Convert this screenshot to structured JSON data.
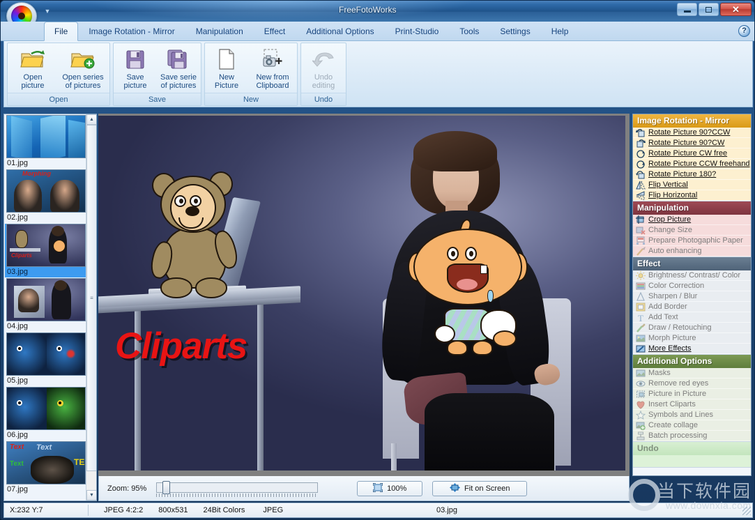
{
  "window": {
    "title": "FreeFotoWorks",
    "controls": {
      "minimize": "_",
      "maximize": "□",
      "close": "✕"
    },
    "quick_access_arrow": "▼"
  },
  "menubar": {
    "tabs": [
      {
        "label": "File",
        "active": true
      },
      {
        "label": "Image Rotation - Mirror",
        "active": false
      },
      {
        "label": "Manipulation",
        "active": false
      },
      {
        "label": "Effect",
        "active": false
      },
      {
        "label": "Additional Options",
        "active": false
      },
      {
        "label": "Print-Studio",
        "active": false
      },
      {
        "label": "Tools",
        "active": false
      },
      {
        "label": "Settings",
        "active": false
      },
      {
        "label": "Help",
        "active": false
      }
    ],
    "help_icon": "?"
  },
  "ribbon": {
    "groups": [
      {
        "name": "Open",
        "buttons": [
          {
            "label": "Open\npicture",
            "icon": "open-folder-icon",
            "disabled": false
          },
          {
            "label": "Open series\nof pictures",
            "icon": "open-folder-plus-icon",
            "disabled": false
          }
        ]
      },
      {
        "name": "Save",
        "buttons": [
          {
            "label": "Save\npicture",
            "icon": "floppy-disk-icon",
            "disabled": false
          },
          {
            "label": "Save serie\nof pictures",
            "icon": "floppy-disk-stack-icon",
            "disabled": false
          }
        ]
      },
      {
        "name": "New",
        "buttons": [
          {
            "label": "New\nPicture",
            "icon": "blank-page-icon",
            "disabled": false
          },
          {
            "label": "New from\nClipboard",
            "icon": "camera-clipboard-icon",
            "disabled": false
          }
        ]
      },
      {
        "name": "Undo",
        "buttons": [
          {
            "label": "Undo\nediting",
            "icon": "undo-arrow-icon",
            "disabled": true
          }
        ]
      }
    ]
  },
  "thumbnails": {
    "items": [
      {
        "name": "01.jpg",
        "selected": false
      },
      {
        "name": "02.jpg",
        "selected": false
      },
      {
        "name": "03.jpg",
        "selected": true
      },
      {
        "name": "04.jpg",
        "selected": false
      },
      {
        "name": "05.jpg",
        "selected": false
      },
      {
        "name": "06.jpg",
        "selected": false
      },
      {
        "name": "07.jpg",
        "selected": false
      }
    ],
    "scroll_up": "▲",
    "scroll_down": "▼",
    "scroll_grip": "≡"
  },
  "canvas": {
    "overlay_text": "Cliparts"
  },
  "zoombar": {
    "zoom_label": "Zoom: 95%",
    "btn_100": "100%",
    "btn_fit": "Fit on Screen",
    "btn_100_icon": "actual-size-icon",
    "btn_fit_icon": "fit-screen-icon"
  },
  "sidebar": {
    "sections": [
      {
        "title": "Image Rotation - Mirror",
        "key": "rot",
        "items": [
          {
            "label": "Rotate Picture 90?CCW",
            "icon": "rotate-ccw-icon",
            "enabled": true
          },
          {
            "label": "Rotate Picture 90?CW",
            "icon": "rotate-cw-icon",
            "enabled": true
          },
          {
            "label": "Rotate Picture CW free",
            "icon": "rotate-cw-free-icon",
            "enabled": true
          },
          {
            "label": "Rotate Picture CCW freehand",
            "icon": "rotate-ccw-free-icon",
            "enabled": true
          },
          {
            "label": "Rotate Picture 180?",
            "icon": "rotate-180-icon",
            "enabled": true
          },
          {
            "label": "Flip Vertical",
            "icon": "flip-vertical-icon",
            "enabled": true
          },
          {
            "label": "Flip Horizontal",
            "icon": "flip-horizontal-icon",
            "enabled": true
          }
        ]
      },
      {
        "title": "Manipulation",
        "key": "man",
        "items": [
          {
            "label": "Crop Picture",
            "icon": "crop-icon",
            "enabled": true
          },
          {
            "label": "Change Size",
            "icon": "resize-icon",
            "enabled": false
          },
          {
            "label": "Prepare Photogaphic Paper",
            "icon": "photo-paper-icon",
            "enabled": false
          },
          {
            "label": "Auto enhancing",
            "icon": "magic-wand-icon",
            "enabled": false
          }
        ]
      },
      {
        "title": "Effect",
        "key": "eff",
        "items": [
          {
            "label": "Brightness/ Contrast/ Color",
            "icon": "brightness-icon",
            "enabled": false
          },
          {
            "label": "Color Correction",
            "icon": "color-bars-icon",
            "enabled": false
          },
          {
            "label": "Sharpen / Blur",
            "icon": "sharpen-icon",
            "enabled": false
          },
          {
            "label": "Add Border",
            "icon": "border-icon",
            "enabled": false
          },
          {
            "label": "Add Text",
            "icon": "text-icon",
            "enabled": false
          },
          {
            "label": "Draw / Retouching",
            "icon": "brush-icon",
            "enabled": false
          },
          {
            "label": "Morph Picture",
            "icon": "morph-icon",
            "enabled": false
          },
          {
            "label": "More Effects",
            "icon": "more-effects-icon",
            "enabled": true
          }
        ]
      },
      {
        "title": "Additional Options",
        "key": "add",
        "items": [
          {
            "label": "Masks",
            "icon": "mask-icon",
            "enabled": false
          },
          {
            "label": "Remove red eyes",
            "icon": "red-eye-icon",
            "enabled": false
          },
          {
            "label": "Picture in Picture",
            "icon": "picture-in-picture-icon",
            "enabled": false
          },
          {
            "label": "Insert Cliparts",
            "icon": "heart-icon",
            "enabled": false
          },
          {
            "label": "Symbols and Lines",
            "icon": "star-icon",
            "enabled": false
          },
          {
            "label": "Create collage",
            "icon": "collage-icon",
            "enabled": false
          },
          {
            "label": "Batch processing",
            "icon": "batch-icon",
            "enabled": false
          }
        ]
      },
      {
        "title": "Undo",
        "key": "und",
        "items": []
      }
    ]
  },
  "statusbar": {
    "coords": "X:232 Y:7",
    "format": "JPEG  4:2:2",
    "dimensions": "800x531",
    "colors": "24Bit Colors",
    "type": "JPEG",
    "filename": "03.jpg"
  },
  "watermark": {
    "cn": "当下软件园",
    "url": "www.downxia.com"
  },
  "colors": {
    "accent_title": "#2e6aa8",
    "section_rotation": "#d99a16",
    "section_manipulation": "#7e343f",
    "section_effect": "#4f6378",
    "section_additional": "#5f7d3c",
    "selection_blue": "#3d9bf0",
    "overlay_red": "#e81414"
  }
}
